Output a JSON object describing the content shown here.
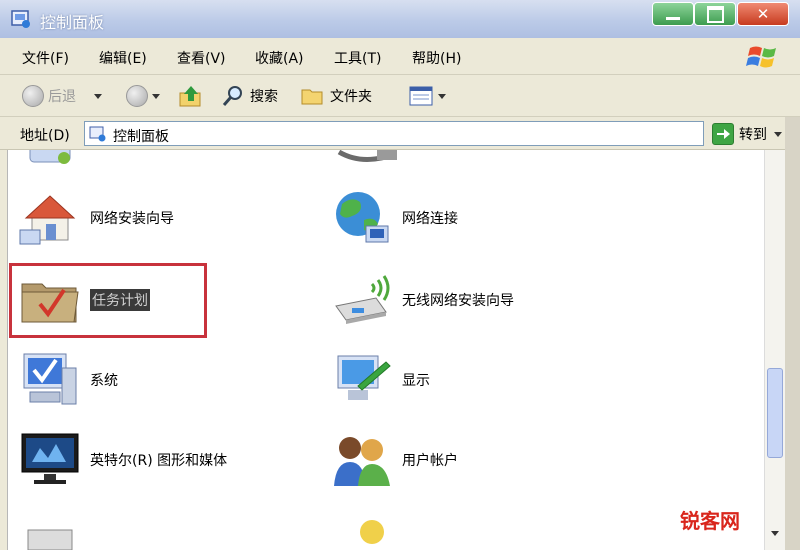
{
  "window": {
    "title": "控制面板"
  },
  "menu": {
    "file": "文件(F)",
    "edit": "编辑(E)",
    "view": "查看(V)",
    "favorites": "收藏(A)",
    "tools": "工具(T)",
    "help": "帮助(H)"
  },
  "toolbar": {
    "back": "后退",
    "search": "搜索",
    "folders": "文件夹"
  },
  "address": {
    "label": "地址(D)",
    "value": "控制面板",
    "go": "转到"
  },
  "items": {
    "network_setup_wizard": "网络安装向导",
    "network_connections": "网络连接",
    "task_scheduler": "任务计划",
    "wireless_network_wizard": "无线网络安装向导",
    "system": "系统",
    "display": "显示",
    "intel_graphics": "英特尔(R) 图形和媒体",
    "user_accounts": "用户帐户"
  },
  "watermark": "锐客网",
  "icons": [
    "control-panel-icon",
    "windows-logo-icon",
    "back-icon",
    "forward-icon",
    "up-folder-icon",
    "search-icon",
    "folders-icon",
    "views-icon",
    "go-arrow-icon",
    "network-setup-icon",
    "network-connections-icon",
    "task-scheduler-icon",
    "wireless-icon",
    "system-icon",
    "display-icon",
    "intel-graphics-icon",
    "user-accounts-icon"
  ]
}
